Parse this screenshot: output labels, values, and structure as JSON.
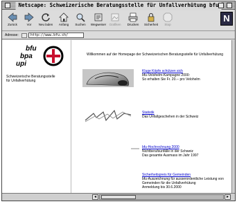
{
  "window": {
    "title": "Netscape: Schweizerische Beratungsstelle für Unfallverhütung bfu"
  },
  "toolbar": {
    "buttons": [
      {
        "label": "Zurück",
        "icon": "back-arrow-icon",
        "enabled": true
      },
      {
        "label": "Vor",
        "icon": "forward-arrow-icon",
        "enabled": true
      },
      {
        "label": "Neu laden",
        "icon": "reload-icon",
        "enabled": true
      },
      {
        "label": "Anfang",
        "icon": "home-icon",
        "enabled": true
      },
      {
        "label": "Suchen",
        "icon": "search-icon",
        "enabled": true
      },
      {
        "label": "Wegweiser",
        "icon": "guide-icon",
        "enabled": true
      },
      {
        "label": "Grafiken",
        "icon": "images-icon",
        "enabled": false
      },
      {
        "label": "Drucken",
        "icon": "print-icon",
        "enabled": true
      },
      {
        "label": "Sicherheit",
        "icon": "security-lock-icon",
        "enabled": true
      },
      {
        "label": "Stop",
        "icon": "stop-icon",
        "enabled": false
      }
    ],
    "brand_logo": "N"
  },
  "location": {
    "label": "Adresse:",
    "url": "http://www.bfu.ch/"
  },
  "sidebar": {
    "logo_lines": [
      "bfu",
      "bpa",
      "upi"
    ],
    "org_line1": "Schweizerische Beratungsstelle",
    "org_line2": "für Unfallverhütung"
  },
  "main": {
    "welcome": "Willkommen auf der Homepage der Schweizerischen Beratungsstelle für Unfallverhütung",
    "items": [
      {
        "link": "Kluge Köpfe schützen sich",
        "lines": [
          "bfu-Velohelm-Kampagne 2000:",
          "So erhalten Sie Fr. 20.-- pro Velohelm"
        ]
      },
      {
        "link": "Statistik",
        "lines": [
          "Das Unfallgeschehen in der Schweiz"
        ]
      },
      {
        "link": "bfu-Hochrechnung 2000",
        "lines": [
          "Nichtberufsunfälle in der Schweiz",
          "Das gesamte Ausmass im Jahr 1997"
        ]
      },
      {
        "link": "Sicherheitspreis für Gemeinden",
        "lines": [
          "bfu-Auszeichnung für ausserordentliche Leistung von",
          "Gemeinden für die Unfallverhütung",
          "Anmeldung bis 30.6.2000"
        ]
      }
    ]
  },
  "colors": {
    "link": "#0000cc",
    "logo_red": "#c8102e",
    "window_chrome": "#d9d9d9"
  }
}
